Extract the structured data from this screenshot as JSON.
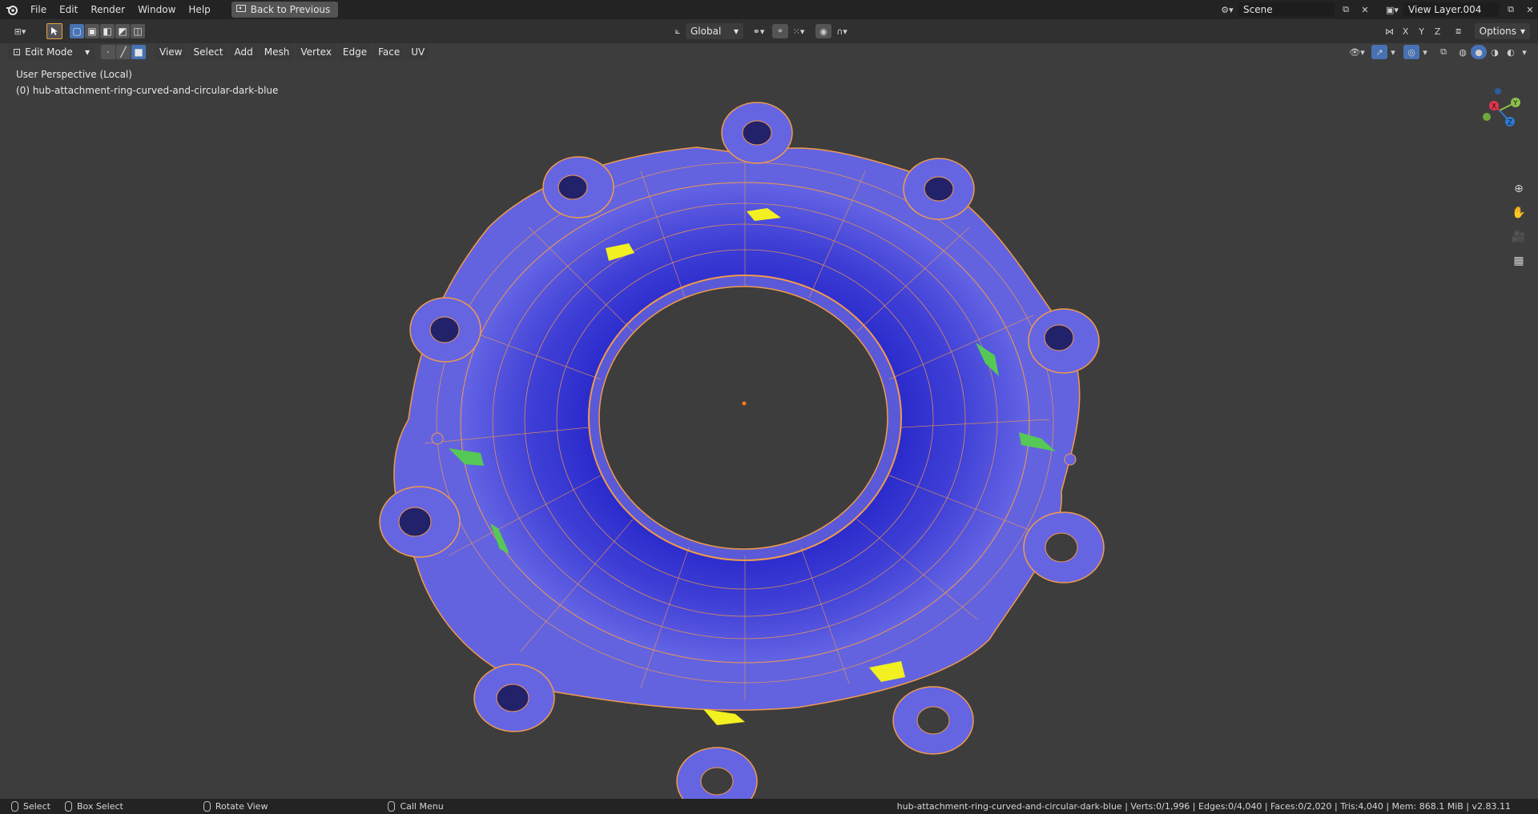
{
  "menu": {
    "items": [
      "File",
      "Edit",
      "Render",
      "Window",
      "Help"
    ],
    "back_label": "Back to Previous"
  },
  "scene": {
    "name": "Scene",
    "view_layer": "View Layer.004"
  },
  "tool": {
    "orientation": "Global",
    "options_label": "Options",
    "axes": [
      "X",
      "Y",
      "Z"
    ]
  },
  "viewport_header": {
    "mode": "Edit Mode",
    "menus": [
      "View",
      "Select",
      "Add",
      "Mesh",
      "Vertex",
      "Edge",
      "Face",
      "UV"
    ]
  },
  "viewport": {
    "perspective_label": "User Perspective (Local)",
    "object_label": "(0) hub-attachment-ring-curved-and-circular-dark-blue"
  },
  "gizmo": {
    "x": "X",
    "y": "Y",
    "z": "Z"
  },
  "status": {
    "hints": [
      {
        "label": "Select"
      },
      {
        "label": "Box Select"
      },
      {
        "label": "Rotate View"
      },
      {
        "label": "Call Menu"
      }
    ],
    "stats": "hub-attachment-ring-curved-and-circular-dark-blue | Verts:0/1,996 | Edges:0/4,040 | Faces:0/2,020 | Tris:4,040 | Mem: 868.1 MiB | v2.83.11"
  },
  "colors": {
    "mesh_face": "#5f5fe0",
    "mesh_dark": "#1c1cc4",
    "wire": "#f29a4a",
    "highlight_yellow": "#f2f020",
    "highlight_green": "#55c855",
    "accent": "#4772b3"
  }
}
